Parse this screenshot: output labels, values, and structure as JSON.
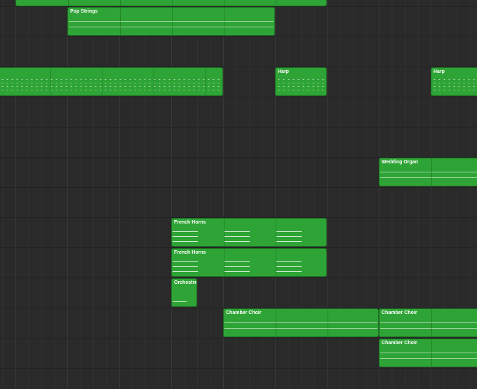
{
  "window": {
    "title": "Arrangement"
  },
  "regions": [
    {
      "label": "",
      "type": "strings"
    },
    {
      "label": "Pop Strings",
      "type": "strings"
    },
    {
      "label": "",
      "type": "dots"
    },
    {
      "label": "Harp",
      "type": "dots"
    },
    {
      "label": "Harp",
      "type": "dots"
    },
    {
      "label": "Wedding Organ",
      "type": "organ"
    },
    {
      "label": "French Horns",
      "type": "horns"
    },
    {
      "label": "French Horns",
      "type": "horns"
    },
    {
      "label": "Orchestral",
      "type": "orch"
    },
    {
      "label": "Chamber Choir",
      "type": "strings"
    },
    {
      "label": "Chamber Choir",
      "type": "strings"
    },
    {
      "label": "Chamber Choir",
      "type": "strings"
    }
  ],
  "colors": {
    "region": "#2fa436",
    "background": "#2a2a2a"
  }
}
